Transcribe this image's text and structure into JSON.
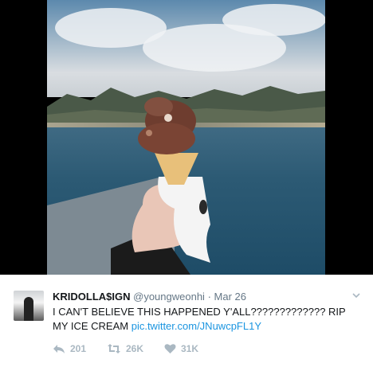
{
  "photo": {
    "alt_icon": "ice-cream-photo"
  },
  "tweet": {
    "display_name": "KRIDOLLA$IGN",
    "handle": "@youngweonhi",
    "separator": "·",
    "date": "Mar 26",
    "text_main": "I CAN'T BELIEVE THIS HAPPENED Y'ALL????????????? RIP MY ICE CREAM ",
    "link_text": "pic.twitter.com/JNuwcpFL1Y",
    "reply_count": "201",
    "retweet_count": "26K",
    "like_count": "31K"
  },
  "icons": {
    "reply": "reply-icon",
    "retweet": "retweet-icon",
    "like": "heart-icon",
    "menu": "chevron-down-icon"
  },
  "colors": {
    "link": "#1b95e0",
    "muted": "#aab8c2",
    "text": "#14171a"
  }
}
